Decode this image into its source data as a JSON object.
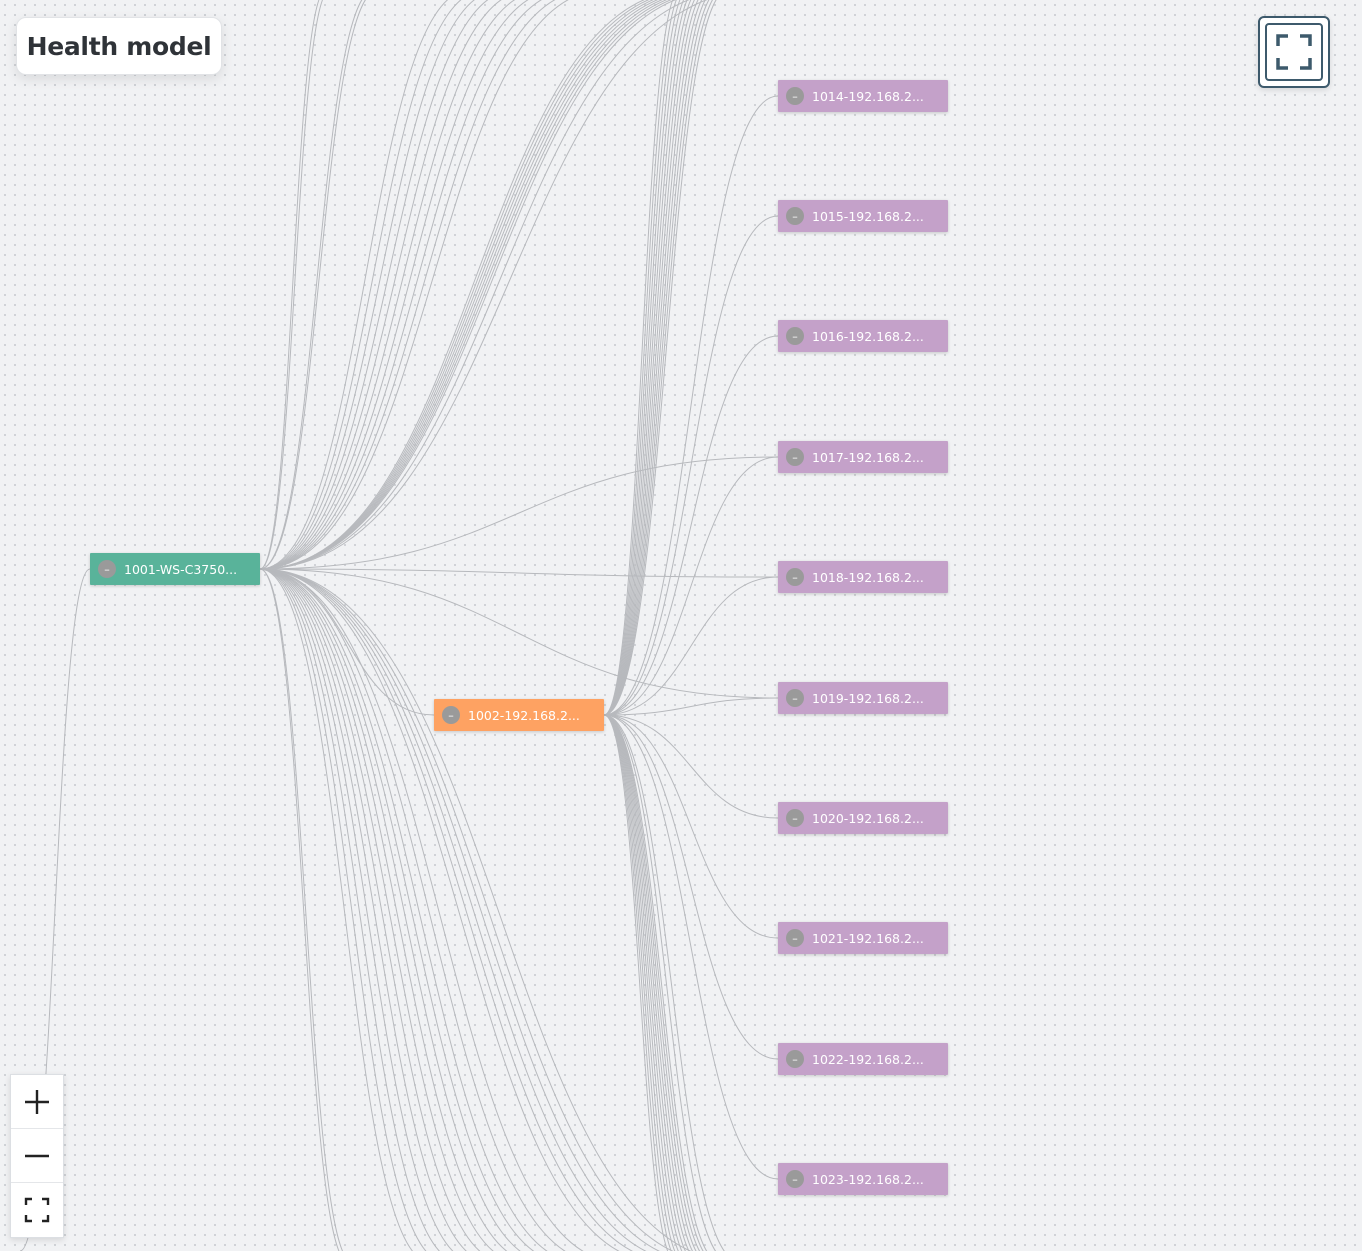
{
  "header": {
    "title": "Health model"
  },
  "toolbar": {
    "fullscreen_icon": "fullscreen-icon"
  },
  "zoom_controls": {
    "zoom_in_icon": "plus-icon",
    "zoom_out_icon": "minus-icon",
    "fit_icon": "fit-screen-icon"
  },
  "colors": {
    "root_node": "#59b39a",
    "parent_node": "#fea262",
    "child_node": "#c4a1c9",
    "edge": "#b7b9bd"
  },
  "nodes": {
    "root": {
      "label": "1001-WS-C3750...",
      "collapse_symbol": "–"
    },
    "parent": {
      "label": "1002-192.168.2...",
      "collapse_symbol": "–"
    },
    "children": [
      {
        "label": "1014-192.168.2...",
        "collapse_symbol": "–"
      },
      {
        "label": "1015-192.168.2...",
        "collapse_symbol": "–"
      },
      {
        "label": "1016-192.168.2...",
        "collapse_symbol": "–"
      },
      {
        "label": "1017-192.168.2...",
        "collapse_symbol": "–"
      },
      {
        "label": "1018-192.168.2...",
        "collapse_symbol": "–"
      },
      {
        "label": "1019-192.168.2...",
        "collapse_symbol": "–"
      },
      {
        "label": "1020-192.168.2...",
        "collapse_symbol": "–"
      },
      {
        "label": "1021-192.168.2...",
        "collapse_symbol": "–"
      },
      {
        "label": "1022-192.168.2...",
        "collapse_symbol": "–"
      },
      {
        "label": "1023-192.168.2...",
        "collapse_symbol": "–"
      }
    ]
  }
}
